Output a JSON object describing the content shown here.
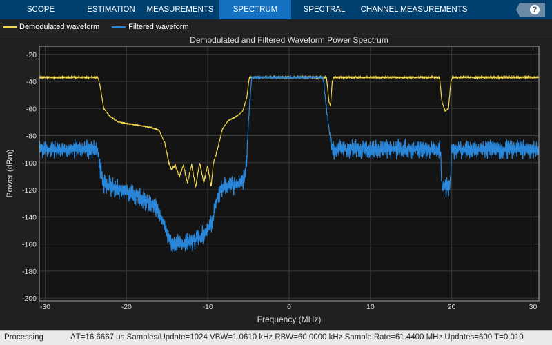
{
  "toolstrip": {
    "tabs": [
      {
        "label": "SCOPE",
        "w": 118
      },
      {
        "label": "ESTIMATION",
        "w": 86
      },
      {
        "label": "MEASUREMENTS",
        "w": 114
      },
      {
        "label": "SPECTRUM",
        "w": 104,
        "active": true
      },
      {
        "label": "SPECTRAL MASK",
        "w": 96
      },
      {
        "label": "CHANNEL MEASUREMENTS",
        "w": 164
      }
    ],
    "help_label": "?"
  },
  "legend": [
    {
      "label": "Demodulated waveform",
      "color": "#f2d94e"
    },
    {
      "label": "Filtered waveform",
      "color": "#2a86d8"
    }
  ],
  "status": {
    "state": "Processing",
    "info": "ΔT=16.6667 us  Samples/Update=1024  VBW=1.0610 kHz  RBW=60.0000 kHz  Sample Rate=61.4400 MHz  Updates=600  T=0.010"
  },
  "chart_data": {
    "type": "line",
    "title": "Demodulated and Filtered Waveform Power Spectrum",
    "xlabel": "Frequency (MHz)",
    "ylabel": "Power (dBm)",
    "xlim": [
      -30.72,
      30.72
    ],
    "ylim": [
      -202,
      -14
    ],
    "xticks": [
      -30,
      -20,
      -10,
      0,
      10,
      20,
      30
    ],
    "yticks": [
      -20,
      -40,
      -60,
      -80,
      -100,
      -120,
      -140,
      -160,
      -180,
      -200
    ],
    "grid": true,
    "series": [
      {
        "name": "Demodulated waveform",
        "color": "#f2d94e",
        "ripple": 1,
        "points": [
          [
            -30.72,
            -37
          ],
          [
            -23.5,
            -37
          ],
          [
            -23.2,
            -45
          ],
          [
            -22.8,
            -60
          ],
          [
            -22,
            -66
          ],
          [
            -21,
            -70
          ],
          [
            -19,
            -72
          ],
          [
            -17,
            -74
          ],
          [
            -16,
            -76
          ],
          [
            -15.3,
            -85
          ],
          [
            -14.8,
            -100
          ],
          [
            -14.5,
            -105
          ],
          [
            -14,
            -102
          ],
          [
            -13.5,
            -110
          ],
          [
            -13,
            -102
          ],
          [
            -12.5,
            -115
          ],
          [
            -12,
            -101
          ],
          [
            -11.5,
            -118
          ],
          [
            -11,
            -100
          ],
          [
            -10.5,
            -115
          ],
          [
            -10,
            -102
          ],
          [
            -9.6,
            -118
          ],
          [
            -9.3,
            -100
          ],
          [
            -8.8,
            -90
          ],
          [
            -8.2,
            -75
          ],
          [
            -7.5,
            -69
          ],
          [
            -6.5,
            -66
          ],
          [
            -5.7,
            -62
          ],
          [
            -5.2,
            -52
          ],
          [
            -4.9,
            -37
          ],
          [
            4.6,
            -37
          ],
          [
            4.9,
            -55
          ],
          [
            5.1,
            -58
          ],
          [
            5.3,
            -40
          ],
          [
            5.5,
            -37
          ],
          [
            18.5,
            -37
          ],
          [
            18.8,
            -55
          ],
          [
            19.2,
            -62
          ],
          [
            19.6,
            -60
          ],
          [
            19.9,
            -40
          ],
          [
            20.1,
            -37
          ],
          [
            30.72,
            -37
          ]
        ]
      },
      {
        "name": "Filtered waveform",
        "color": "#2a86d8",
        "ripple": 7,
        "points": [
          [
            -30.72,
            -90
          ],
          [
            -23.6,
            -90
          ],
          [
            -23.2,
            -105
          ],
          [
            -22.8,
            -115
          ],
          [
            -21,
            -120
          ],
          [
            -19,
            -124
          ],
          [
            -17,
            -130
          ],
          [
            -16,
            -137
          ],
          [
            -15.2,
            -150
          ],
          [
            -14.5,
            -160
          ],
          [
            -13,
            -160
          ],
          [
            -12,
            -158
          ],
          [
            -11,
            -155
          ],
          [
            -10,
            -150
          ],
          [
            -9.3,
            -140
          ],
          [
            -8.8,
            -125
          ],
          [
            -8,
            -118
          ],
          [
            -6.5,
            -116
          ],
          [
            -5.5,
            -112
          ],
          [
            -5.2,
            -95
          ],
          [
            -4.9,
            -60
          ],
          [
            -4.6,
            -37
          ],
          [
            4.2,
            -37
          ],
          [
            4.5,
            -55
          ],
          [
            4.9,
            -75
          ],
          [
            5.3,
            -90
          ],
          [
            18.6,
            -90
          ],
          [
            18.8,
            -118
          ],
          [
            19.8,
            -118
          ],
          [
            20,
            -90
          ],
          [
            30.72,
            -90
          ]
        ]
      }
    ]
  }
}
